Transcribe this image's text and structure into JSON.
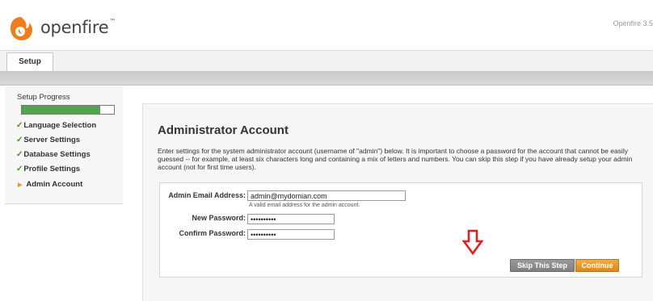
{
  "header": {
    "logo_text": "openfire",
    "logo_tm": "™",
    "version": "Openfire 3.5"
  },
  "tabs": [
    {
      "label": "Setup"
    }
  ],
  "sidebar": {
    "title": "Setup Progress",
    "progress": 0.85,
    "steps": [
      {
        "label": "Language Selection",
        "done": true
      },
      {
        "label": "Server Settings",
        "done": true
      },
      {
        "label": "Database Settings",
        "done": true
      },
      {
        "label": "Profile Settings",
        "done": true
      },
      {
        "label": "Admin Account",
        "done": false,
        "current": true
      }
    ]
  },
  "main": {
    "title": "Administrator Account",
    "description": "Enter settings for the system administrator account (username of \"admin\") below. It is important to choose a password for the account that cannot be easily guessed -- for example, at least six characters long and containing a mix of letters and numbers. You can skip this step if you have already setup your admin account (not for first time users).",
    "form": {
      "email_label": "Admin Email Address:",
      "email_value": "admin@mydomian.com",
      "email_hint": "A valid email address for the admin account.",
      "new_password_label": "New Password:",
      "new_password_value": "••••••••••",
      "confirm_password_label": "Confirm Password:",
      "confirm_password_value": "••••••••••"
    },
    "buttons": {
      "skip": "Skip This Step",
      "continue": "Continue"
    }
  },
  "colors": {
    "accent_orange": "#d98a1e",
    "progress_green": "#53a34a",
    "annotation_red": "#e02020"
  }
}
